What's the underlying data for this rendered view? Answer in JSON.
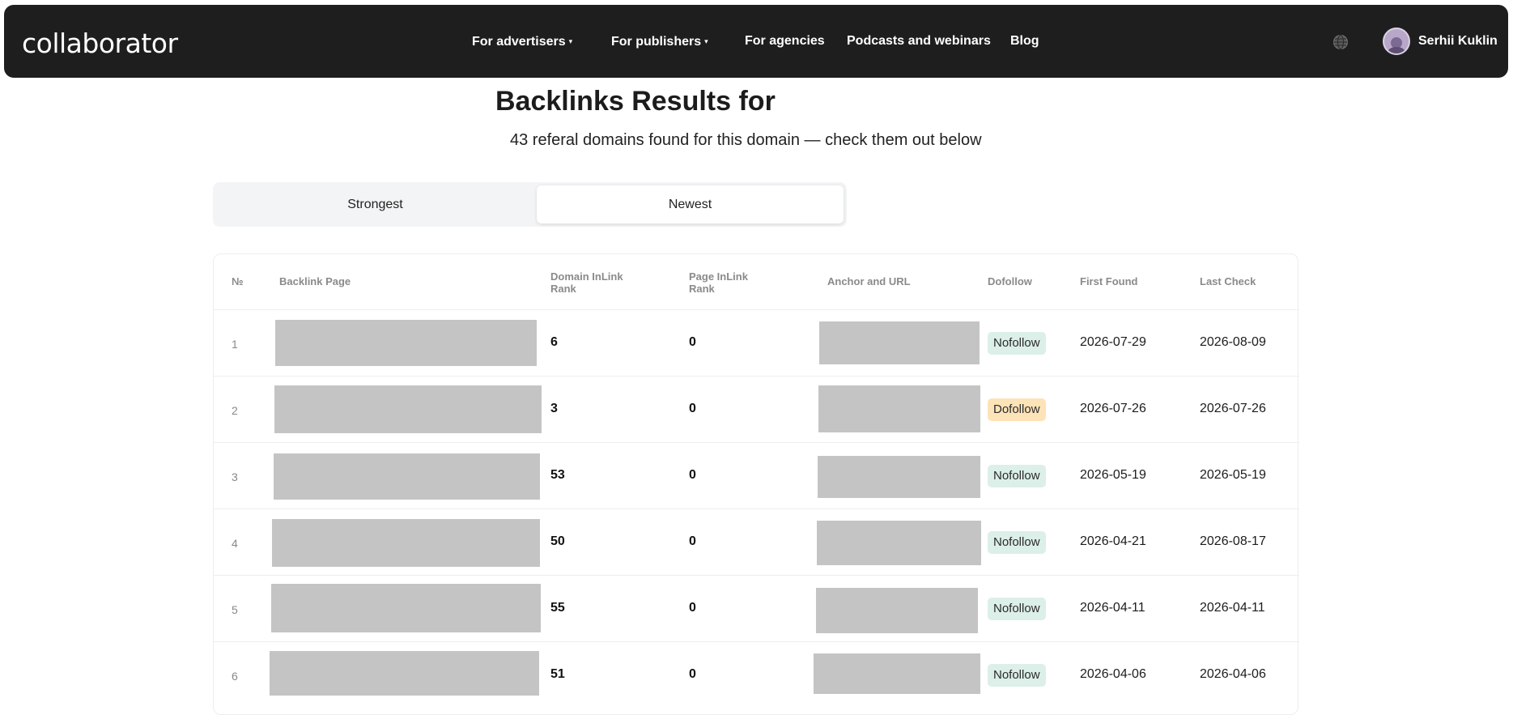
{
  "nav": {
    "logo": "collaborator",
    "items": [
      {
        "label": "For advertisers",
        "caret": "▾"
      },
      {
        "label": "For publishers",
        "caret": "▾"
      },
      {
        "label": "For agencies",
        "caret": ""
      },
      {
        "label": "Podcasts and webinars",
        "caret": ""
      },
      {
        "label": "Blog",
        "caret": ""
      }
    ],
    "user_name": "Serhii Kuklin"
  },
  "page": {
    "title": "Backlinks Results for",
    "subtitle": "43 referal domains found for this domain — check them out below"
  },
  "tabs": [
    {
      "label": "Strongest",
      "active": false
    },
    {
      "label": "Newest",
      "active": true
    }
  ],
  "table": {
    "headers": {
      "num": "№",
      "backlink_page": "Backlink Page",
      "domain_rank_1": "Domain InLink",
      "domain_rank_2": "Rank",
      "page_rank_1": "Page InLink",
      "page_rank_2": "Rank",
      "anchor": "Anchor and URL",
      "dofollow": "Dofollow",
      "first_found": "First Found",
      "last_check": "Last Check"
    },
    "rows": [
      {
        "num": "1",
        "domain_rank": "6",
        "page_rank": "0",
        "follow": "Nofollow",
        "first_found": "2026-07-29",
        "last_check": "2026-08-09"
      },
      {
        "num": "2",
        "domain_rank": "3",
        "page_rank": "0",
        "follow": "Dofollow",
        "first_found": "2026-07-26",
        "last_check": "2026-07-26"
      },
      {
        "num": "3",
        "domain_rank": "53",
        "page_rank": "0",
        "follow": "Nofollow",
        "first_found": "2026-05-19",
        "last_check": "2026-05-19"
      },
      {
        "num": "4",
        "domain_rank": "50",
        "page_rank": "0",
        "follow": "Nofollow",
        "first_found": "2026-04-21",
        "last_check": "2026-08-17"
      },
      {
        "num": "5",
        "domain_rank": "55",
        "page_rank": "0",
        "follow": "Nofollow",
        "first_found": "2026-04-11",
        "last_check": "2026-04-11"
      },
      {
        "num": "6",
        "domain_rank": "51",
        "page_rank": "0",
        "follow": "Nofollow",
        "first_found": "2026-04-06",
        "last_check": "2026-04-06"
      }
    ]
  },
  "colors": {
    "navbar": "#1e1e1e",
    "nofollow_badge": "#dcefe9",
    "dofollow_badge": "#fde3b8",
    "redacted": "#c4c4c4"
  }
}
